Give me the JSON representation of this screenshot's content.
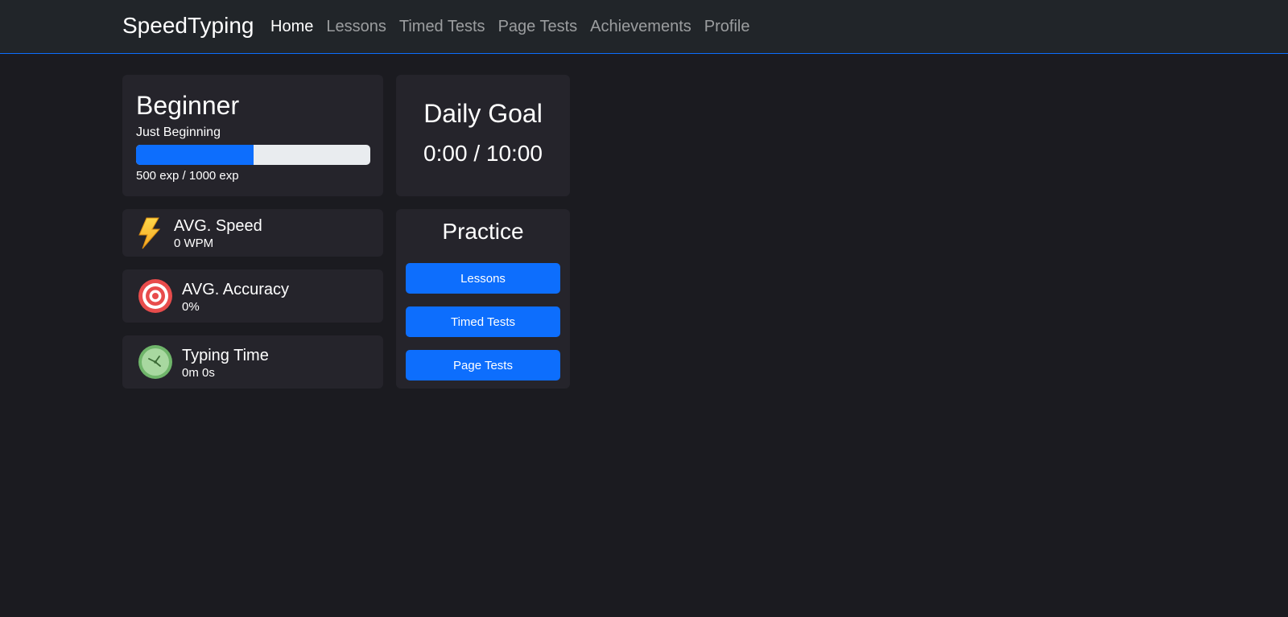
{
  "nav": {
    "brand": "SpeedTyping",
    "links": [
      {
        "label": "Home",
        "active": true
      },
      {
        "label": "Lessons"
      },
      {
        "label": "Timed Tests"
      },
      {
        "label": "Page Tests"
      },
      {
        "label": "Achievements"
      },
      {
        "label": "Profile"
      }
    ]
  },
  "level": {
    "title": "Beginner",
    "subtitle": "Just Beginning",
    "exp_text": "500 exp / 1000 exp",
    "progress_fraction": 0.5
  },
  "daily_goal": {
    "title": "Daily Goal",
    "value": "0:00 / 10:00"
  },
  "stats": {
    "speed": {
      "label": "AVG. Speed",
      "value": "0 WPM",
      "icon": "lightning-icon"
    },
    "accuracy": {
      "label": "AVG. Accuracy",
      "value": "0%",
      "icon": "target-icon"
    },
    "time": {
      "label": "Typing Time",
      "value": "0m 0s",
      "icon": "clock-icon"
    }
  },
  "practice": {
    "title": "Practice",
    "buttons": [
      "Lessons",
      "Timed Tests",
      "Page Tests"
    ]
  },
  "colors": {
    "accent": "#0d6efd",
    "background": "#1b1b20",
    "card": "#25242b",
    "navbar": "#212529"
  }
}
